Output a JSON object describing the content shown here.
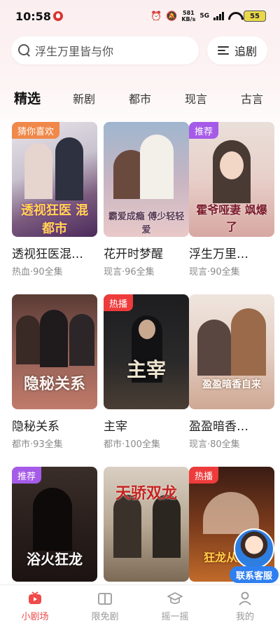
{
  "status_bar": {
    "time": "10:58",
    "speed_value": "581",
    "speed_unit": "KB/s",
    "network": "5G",
    "battery": "55"
  },
  "search": {
    "placeholder": "浮生万里皆与你",
    "icon": "search-icon"
  },
  "follow_button": {
    "label": "追剧",
    "icon": "list-icon"
  },
  "tabs": [
    {
      "label": "精选",
      "active": true
    },
    {
      "label": "新剧",
      "active": false
    },
    {
      "label": "都市",
      "active": false
    },
    {
      "label": "现言",
      "active": false
    },
    {
      "label": "古言",
      "active": false
    }
  ],
  "cards": [
    {
      "title": "透视狂医混…",
      "meta": "热血·90全集",
      "tag": "猜你喜欢",
      "poster_text": "透视狂医 混都市"
    },
    {
      "title": "花开时梦醒",
      "meta": "现言·96全集",
      "tag": "",
      "poster_text": "霸爱成瘾 傅少轻轻爱"
    },
    {
      "title": "浮生万里…",
      "meta": "现言·90全集",
      "tag": "推荐",
      "poster_text": "霍爷哑妻 飒爆了"
    },
    {
      "title": "隐秘关系",
      "meta": "都市·93全集",
      "tag": "",
      "poster_text": "隐秘关系"
    },
    {
      "title": "主宰",
      "meta": "都市·100全集",
      "tag": "热播",
      "poster_text": "主宰"
    },
    {
      "title": "盈盈暗香…",
      "meta": "现言·80全集",
      "tag": "",
      "poster_text": "盈盈暗香自来"
    },
    {
      "title": "",
      "meta": "",
      "tag": "推荐",
      "poster_text": "浴火狂龙"
    },
    {
      "title": "",
      "meta": "",
      "tag": "",
      "poster_text": "天骄双龙"
    },
    {
      "title": "",
      "meta": "",
      "tag": "热播",
      "poster_text": "狂龙从监狱"
    }
  ],
  "service": {
    "label": "联系客服"
  },
  "bottom_nav": [
    {
      "label": "小剧场",
      "icon": "theater-icon",
      "active": true
    },
    {
      "label": "限免剧",
      "icon": "book-icon",
      "active": false
    },
    {
      "label": "摇一摇",
      "icon": "graduation-cap-icon",
      "active": false
    },
    {
      "label": "我的",
      "icon": "person-icon",
      "active": false
    }
  ],
  "colors": {
    "accent": "#f04a4a",
    "tag_orange": "#f0884a",
    "tag_purple": "#a65be8",
    "tag_red": "#ee3b3b",
    "service_blue": "#2f7ff0"
  }
}
